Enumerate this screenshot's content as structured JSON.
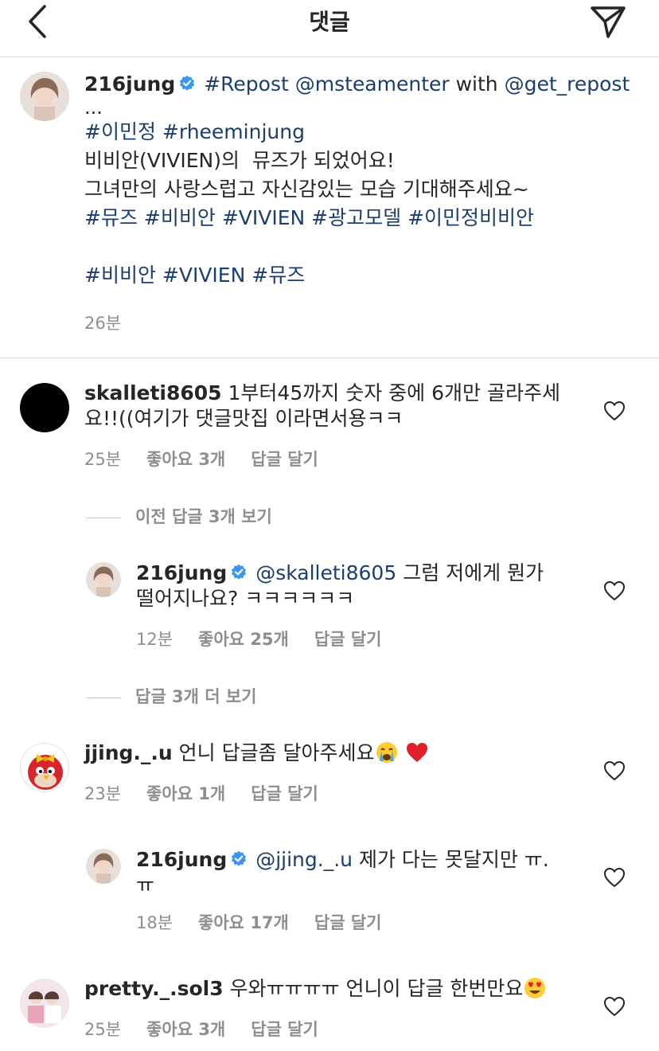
{
  "header": {
    "title": "댓글"
  },
  "post": {
    "username": "216jung",
    "caption_tag1": "#Repost",
    "caption_mention": "@msteamenter",
    "caption_with": "with",
    "caption_mention2": "@get_repost",
    "caption_ellipsis": "...",
    "hashtags_line1_a": "#이민정",
    "hashtags_line1_b": "#rheeminjung",
    "line2": "비비안(VIVIEN)의  뮤즈가 되었어요!",
    "line3": "그녀만의 사랑스럽고 자신감있는 모습 기대해주세요~",
    "hashtags_line4": [
      "#뮤즈",
      "#비비안",
      "#VIVIEN",
      "#광고모델",
      "#이민정비비안"
    ],
    "hashtags_line5": [
      "#비비안",
      "#VIVIEN",
      "#뮤즈"
    ],
    "time": "26분"
  },
  "comments": [
    {
      "username": "skalleti8605",
      "text": "1부터45까지 숫자 중에 6개만 골라주세요!!((여기가 댓글맛집 이라면서용ㅋㅋ",
      "time": "25분",
      "likes": "좋아요 3개",
      "reply": "답글 달기"
    },
    {
      "view_prev": "이전 답글 3개 보기"
    },
    {
      "username": "216jung",
      "mention": "@skalleti8605",
      "text": "그럼 저에게 뭔가 떨어지나요? ㅋㅋㅋㅋㅋㅋ",
      "time": "12분",
      "likes": "좋아요 25개",
      "reply": "답글 달기"
    },
    {
      "view_more": "답글 3개 더 보기"
    },
    {
      "username": "jjing._.u",
      "text": "언니 답글좀 달아주세요",
      "time": "23분",
      "likes": "좋아요 1개",
      "reply": "답글 달기"
    },
    {
      "username": "216jung",
      "mention": "@jjing._.u",
      "text": "제가 다는 못달지만 ㅠ.ㅠ",
      "time": "18분",
      "likes": "좋아요 17개",
      "reply": "답글 달기"
    },
    {
      "username": "pretty._.sol3",
      "text": "우와ㅠㅠㅠㅠ 언니이 답글 한번만요",
      "time": "25분",
      "likes": "좋아요 3개",
      "reply": "답글 달기"
    }
  ],
  "icons": {
    "back": "chevron-left-icon",
    "send": "paper-plane-icon",
    "verified": "verified-badge-icon",
    "heart": "heart-outline-icon"
  },
  "colors": {
    "hashtag": "#1c3e6e",
    "verified": "#3897f0",
    "meta": "#8e8e8e"
  }
}
